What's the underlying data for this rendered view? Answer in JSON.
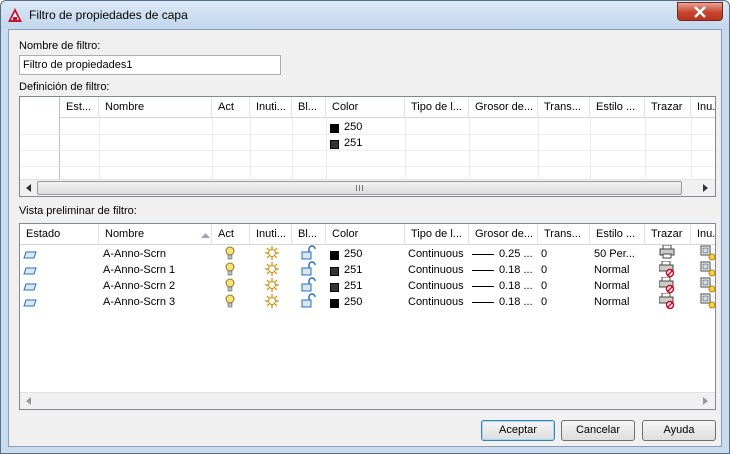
{
  "window": {
    "title": "Filtro de propiedades de capa"
  },
  "filter_name": {
    "label": "Nombre de filtro:",
    "value": "Filtro de propiedades1"
  },
  "definition": {
    "label": "Definición de filtro:",
    "columns": [
      "Est...",
      "Nombre",
      "Act",
      "Inuti...",
      "Bl...",
      "Color",
      "Tipo de l...",
      "Grosor de...",
      "Trans...",
      "Estilo ...",
      "Trazar",
      "Inu..."
    ],
    "rows": [
      {
        "color": "250",
        "color_hex": "#000000"
      },
      {
        "color": "251",
        "color_hex": "#333333"
      }
    ]
  },
  "preview": {
    "label": "Vista preliminar de filtro:",
    "columns": [
      "Estado",
      "Nombre",
      "Act",
      "Inuti...",
      "Bl...",
      "Color",
      "Tipo de l...",
      "Grosor de...",
      "Trans...",
      "Estilo ...",
      "Trazar",
      "Inu..."
    ],
    "rows": [
      {
        "name": "A-Anno-Scrn",
        "color": "250",
        "color_hex": "#000000",
        "linetype": "Continuous",
        "lineweight": "0.25 ...",
        "transparency": "0",
        "plot_style": "50 Per...",
        "plot": "printer-icon"
      },
      {
        "name": "A-Anno-Scrn 1",
        "color": "251",
        "color_hex": "#333333",
        "linetype": "Continuous",
        "lineweight": "0.18 ...",
        "transparency": "0",
        "plot_style": "Normal",
        "plot": "no-plot-icon"
      },
      {
        "name": "A-Anno-Scrn 2",
        "color": "251",
        "color_hex": "#333333",
        "linetype": "Continuous",
        "lineweight": "0.18 ...",
        "transparency": "0",
        "plot_style": "Normal",
        "plot": "no-plot-icon"
      },
      {
        "name": "A-Anno-Scrn 3",
        "color": "250",
        "color_hex": "#000000",
        "linetype": "Continuous",
        "lineweight": "0.18 ...",
        "transparency": "0",
        "plot_style": "Normal",
        "plot": "no-plot-icon"
      }
    ]
  },
  "buttons": {
    "accept": "Aceptar",
    "cancel": "Cancelar",
    "help": "Ayuda"
  },
  "colors": {
    "titlebar": "#c9dbef",
    "close": "#c7442e",
    "lightbulb": "#f5e27a",
    "lock_blue": "#2d6fb8"
  }
}
